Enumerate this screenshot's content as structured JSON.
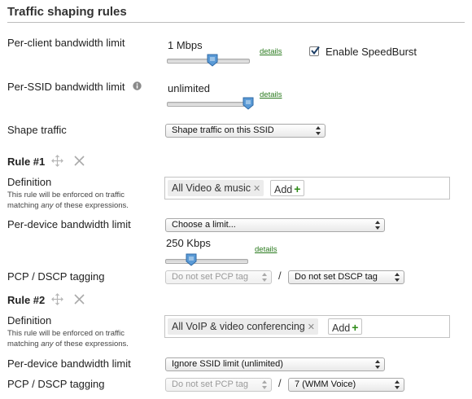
{
  "section_title": "Traffic shaping rules",
  "per_client": {
    "label": "Per-client bandwidth limit",
    "value": "1 Mbps",
    "details": "details",
    "slider_level_pct": 58,
    "speedburst_label": "Enable SpeedBurst",
    "speedburst_checked": true
  },
  "per_ssid": {
    "label": "Per-SSID bandwidth limit",
    "value": "unlimited",
    "details": "details",
    "slider_level_pct": 100
  },
  "shape_traffic": {
    "label": "Shape traffic",
    "selected": "Shape traffic on this SSID"
  },
  "rules": [
    {
      "title": "Rule #1",
      "definition_label": "Definition",
      "note_line1": "This rule will be enforced on traffic",
      "note_pre": "matching ",
      "note_em": "any",
      "note_post": " of these expressions.",
      "tag": "All Video & music",
      "add_label": "Add",
      "per_device_label": "Per-device bandwidth limit",
      "per_device_selected": "Choose a limit...",
      "per_device_value": "250 Kbps",
      "details": "details",
      "slider_level_pct": 33,
      "pcp_label": "PCP / DSCP tagging",
      "pcp_selected": "Do not set PCP tag",
      "slash": "/",
      "dscp_selected": "Do not set DSCP tag"
    },
    {
      "title": "Rule #2",
      "definition_label": "Definition",
      "note_line1": "This rule will be enforced on traffic",
      "note_pre": "matching ",
      "note_em": "any",
      "note_post": " of these expressions.",
      "tag": "All VoIP & video conferencing",
      "add_label": "Add",
      "per_device_label": "Per-device bandwidth limit",
      "per_device_selected": "Ignore SSID limit (unlimited)",
      "pcp_label": "PCP / DSCP tagging",
      "pcp_selected": "Do not set PCP tag",
      "slash": "/",
      "dscp_selected": "7 (WMM Voice)"
    }
  ],
  "icons": {
    "move": "move-icon",
    "remove": "close-icon",
    "info": "info-icon",
    "add": "plus-icon"
  },
  "colors": {
    "link": "#2a7a1e",
    "add_plus": "#2e8b17",
    "slider_handle": "#4b8fd1"
  }
}
